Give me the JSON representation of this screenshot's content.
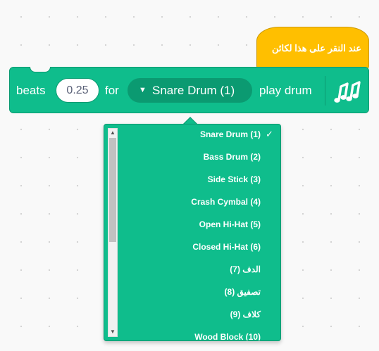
{
  "hat_block": {
    "label": "عند النقر على هذا لكائن"
  },
  "block": {
    "beats_label": "beats",
    "beats_value": "0.25",
    "for_label": "for",
    "drum_selected": "Snare Drum (1)",
    "action_label": "play drum",
    "extension_icon": "music-notes-icon"
  },
  "dropdown": {
    "items": [
      {
        "label": "Snare Drum (1)",
        "checked": true
      },
      {
        "label": "Bass Drum (2)"
      },
      {
        "label": "Side Stick (3)"
      },
      {
        "label": "Crash Cymbal (4)"
      },
      {
        "label": "Open Hi-Hat (5)"
      },
      {
        "label": "Closed Hi-Hat (6)"
      },
      {
        "label": "الدف (7)"
      },
      {
        "label": "تصفيق (8)"
      },
      {
        "label": "كلاف (9)"
      },
      {
        "label": "Wood Block (10)"
      }
    ],
    "check_mark": "✓"
  },
  "colors": {
    "motion_green": "#0fbd8c",
    "green_dark": "#0b9a71",
    "event_yellow": "#ffbf00"
  }
}
